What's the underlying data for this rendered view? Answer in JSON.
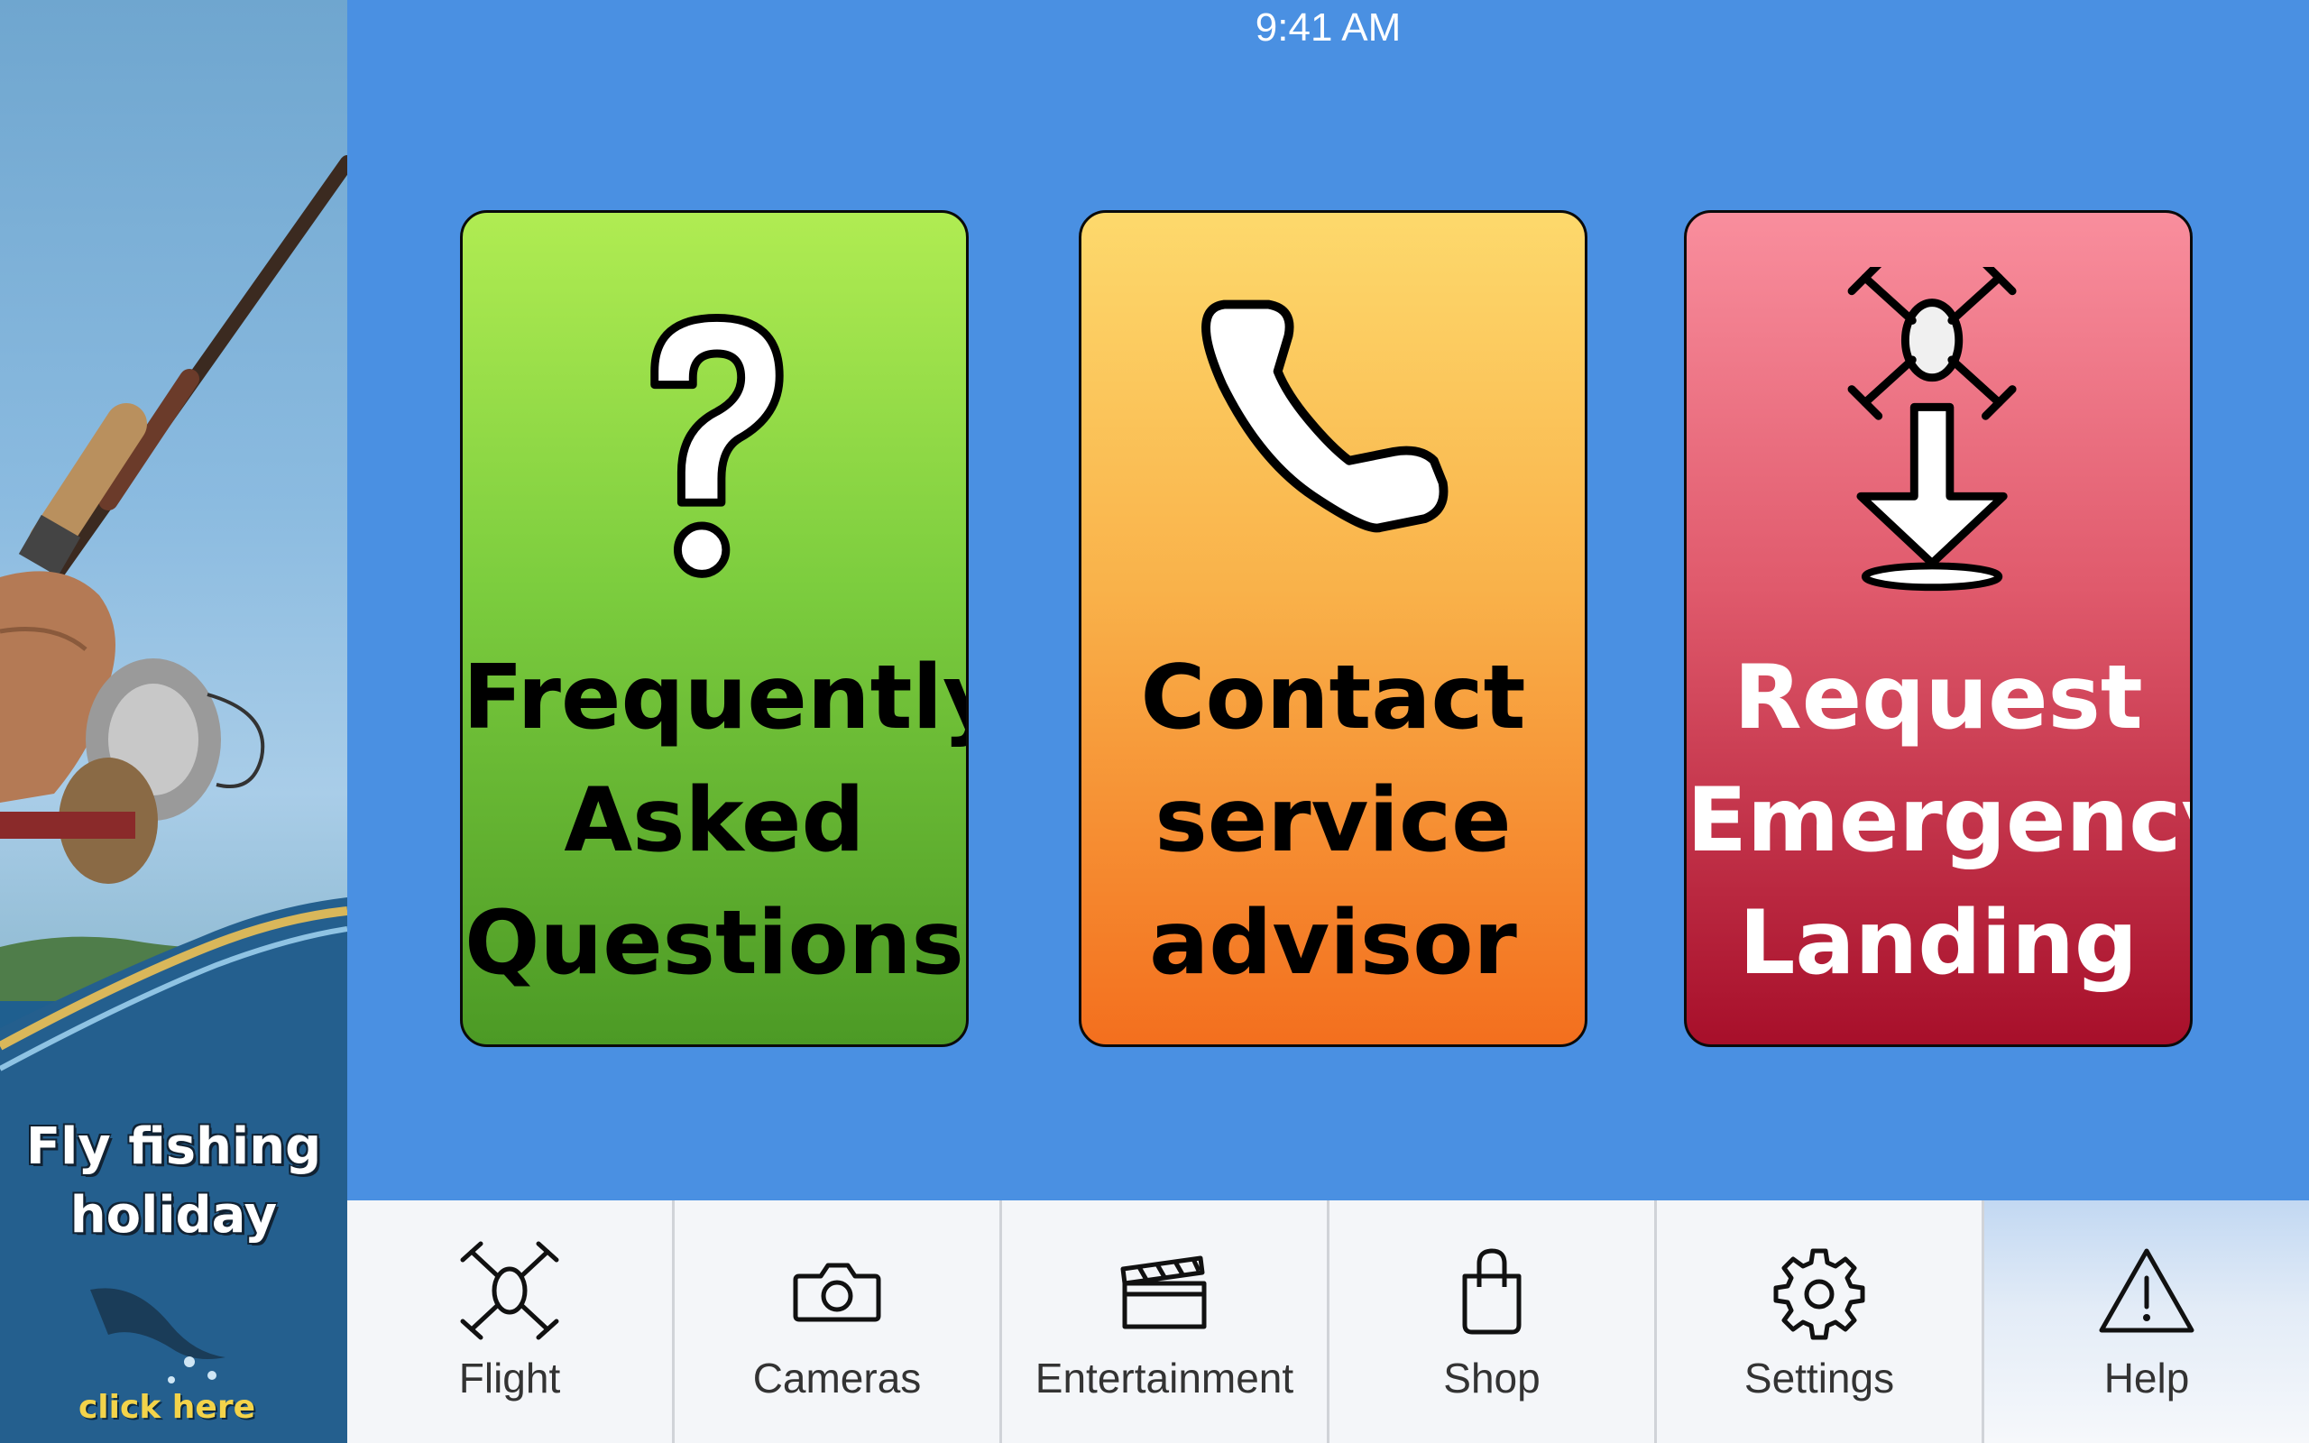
{
  "status_bar": {
    "time": "9:41 AM"
  },
  "ad": {
    "title_line1": "Fly fishing",
    "title_line2": "holiday",
    "cta": "click here"
  },
  "cards": [
    {
      "id": "faq",
      "icon": "question-mark-icon",
      "lines": [
        "Frequently",
        "Asked",
        "Questions"
      ],
      "color": "#7ccd3e"
    },
    {
      "id": "contact",
      "icon": "phone-icon",
      "lines": [
        "Contact",
        "service",
        "advisor"
      ],
      "color": "#f9a23a"
    },
    {
      "id": "emergency",
      "icon": "drone-landing-icon",
      "lines": [
        "Request",
        "Emergency",
        "Landing"
      ],
      "color": "#c8283f"
    }
  ],
  "tabs": [
    {
      "label": "Flight",
      "icon": "drone-icon",
      "active": false
    },
    {
      "label": "Cameras",
      "icon": "camera-icon",
      "active": false
    },
    {
      "label": "Entertainment",
      "icon": "clapperboard-icon",
      "active": false
    },
    {
      "label": "Shop",
      "icon": "shopping-bag-icon",
      "active": false
    },
    {
      "label": "Settings",
      "icon": "gear-icon",
      "active": false
    },
    {
      "label": "Help",
      "icon": "warning-icon",
      "active": true
    }
  ],
  "colors": {
    "background": "#4a90e2",
    "tabbar": "#f4f6f9",
    "active_tab": "#c2d8f2"
  }
}
